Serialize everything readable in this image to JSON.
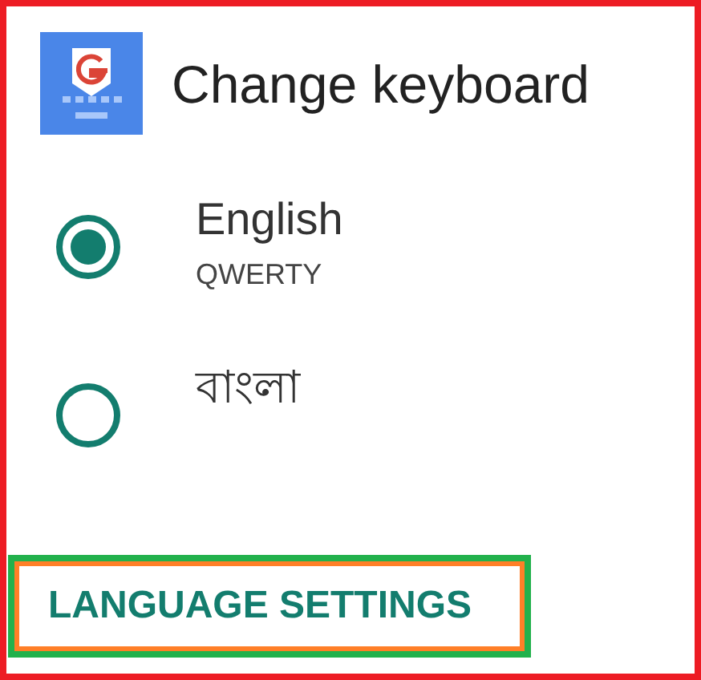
{
  "dialog": {
    "title": "Change keyboard"
  },
  "options": [
    {
      "label": "English",
      "sublabel": "QWERTY",
      "selected": true
    },
    {
      "label": "বাংলা",
      "selected": false
    }
  ],
  "button": {
    "label": "LANGUAGE SETTINGS"
  }
}
